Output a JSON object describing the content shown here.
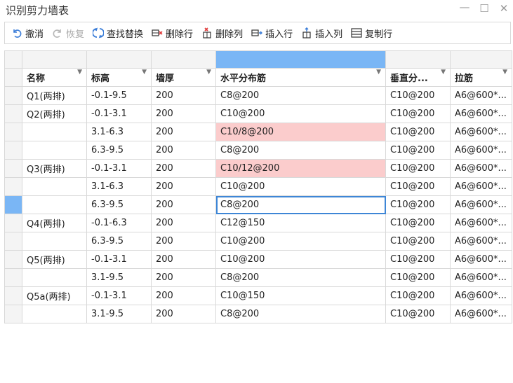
{
  "window": {
    "title": "识别剪力墙表",
    "minimize": "—",
    "maximize": "☐",
    "close": "✕"
  },
  "toolbar": {
    "undo": "撤消",
    "redo": "恢复",
    "find_replace": "查找替换",
    "delete_row": "删除行",
    "delete_col": "删除列",
    "insert_row": "插入行",
    "insert_col": "插入列",
    "copy_row": "复制行"
  },
  "table": {
    "headers": [
      "名称",
      "标高",
      "墙厚",
      "水平分布筋",
      "垂直分...",
      "拉筋"
    ],
    "rows": [
      [
        "Q1(两排)",
        "-0.1-9.5",
        "200",
        "C8@200",
        "C10@200",
        "A6@600*..."
      ],
      [
        "Q2(两排)",
        "-0.1-3.1",
        "200",
        "C10@200",
        "C10@200",
        "A6@600*..."
      ],
      [
        "",
        "3.1-6.3",
        "200",
        "C10/8@200",
        "C10@200",
        "A6@600*..."
      ],
      [
        "",
        "6.3-9.5",
        "200",
        "C8@200",
        "C10@200",
        "A6@600*..."
      ],
      [
        "Q3(两排)",
        "-0.1-3.1",
        "200",
        "C10/12@200",
        "C10@200",
        "A6@600*..."
      ],
      [
        "",
        "3.1-6.3",
        "200",
        "C10@200",
        "C10@200",
        "A6@600*..."
      ],
      [
        "",
        "6.3-9.5",
        "200",
        "C8@200",
        "C10@200",
        "A6@600*..."
      ],
      [
        "Q4(两排)",
        "-0.1-6.3",
        "200",
        "C12@150",
        "C10@200",
        "A6@600*..."
      ],
      [
        "",
        "6.3-9.5",
        "200",
        "C10@200",
        "C10@200",
        "A6@600*..."
      ],
      [
        "Q5(两排)",
        "-0.1-3.1",
        "200",
        "C10@200",
        "C10@200",
        "A6@600*..."
      ],
      [
        "",
        "3.1-9.5",
        "200",
        "C8@200",
        "C10@200",
        "A6@600*..."
      ],
      [
        "Q5a(两排)",
        "-0.1-3.1",
        "200",
        "C10@150",
        "C10@200",
        "A6@600*..."
      ],
      [
        "",
        "3.1-9.5",
        "200",
        "C8@200",
        "C10@200",
        "A6@600*..."
      ]
    ],
    "highlight_color": "#fbcccc",
    "selection_color": "#7ab6f5",
    "selected_cell_border": "#3e86d6"
  }
}
